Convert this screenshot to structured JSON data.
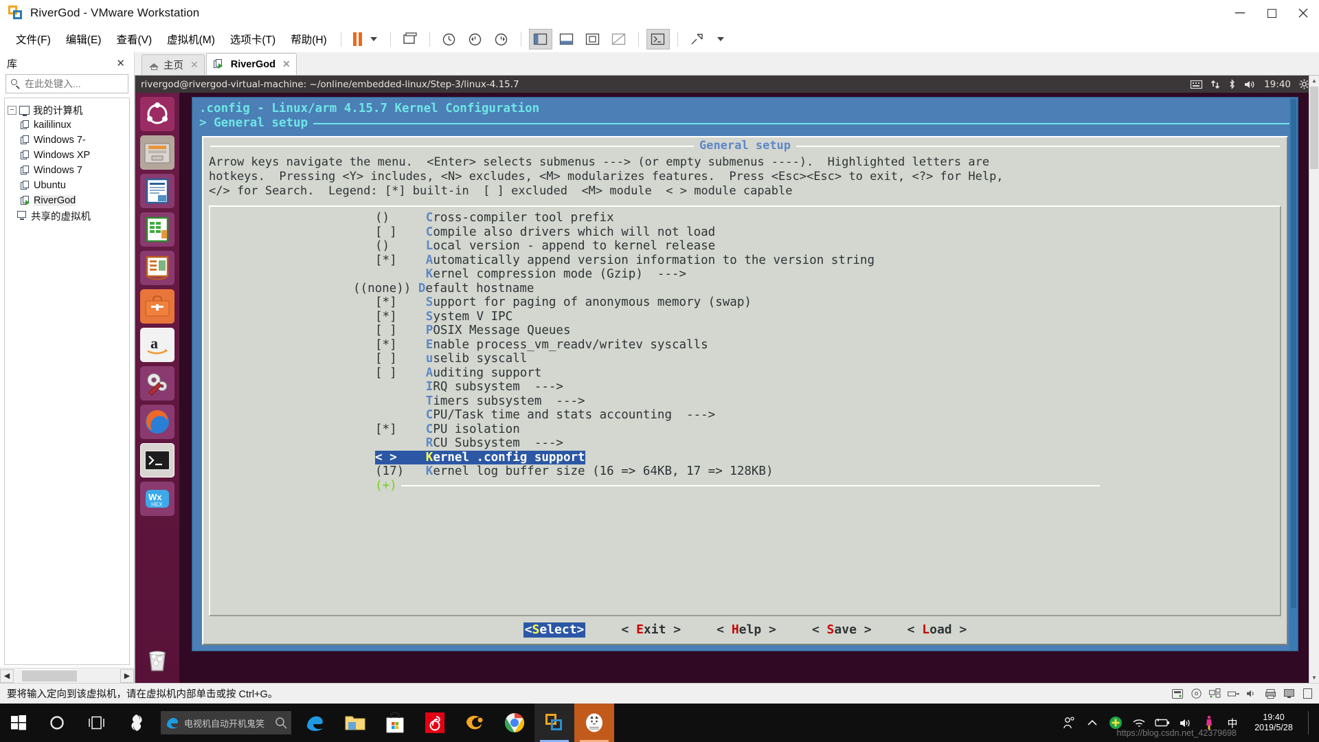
{
  "window": {
    "title": "RiverGod - VMware Workstation",
    "minimize": "–",
    "maximize": "❐",
    "close": "✕"
  },
  "menubar": {
    "items": [
      {
        "label": "文件(F)",
        "name": "menu-file"
      },
      {
        "label": "编辑(E)",
        "name": "menu-edit"
      },
      {
        "label": "查看(V)",
        "name": "menu-view"
      },
      {
        "label": "虚拟机(M)",
        "name": "menu-vm"
      },
      {
        "label": "选项卡(T)",
        "name": "menu-tabs"
      },
      {
        "label": "帮助(H)",
        "name": "menu-help"
      }
    ]
  },
  "library": {
    "title": "库",
    "close": "✕",
    "search_placeholder": "在此处键入...",
    "search_value": "",
    "tree": [
      {
        "label": "我的计算机",
        "type": "root",
        "indent": 0,
        "expander": "−"
      },
      {
        "label": "kaililinux",
        "type": "vm",
        "indent": 1
      },
      {
        "label": "Windows 7-",
        "type": "vm",
        "indent": 1
      },
      {
        "label": "Windows XP",
        "type": "vm",
        "indent": 1
      },
      {
        "label": "Windows 7",
        "type": "vm",
        "indent": 1
      },
      {
        "label": "Ubuntu",
        "type": "vm",
        "indent": 1
      },
      {
        "label": "RiverGod",
        "type": "vm-running",
        "indent": 1,
        "selected": true
      },
      {
        "label": "共享的虚拟机",
        "type": "shared",
        "indent": 0
      }
    ]
  },
  "tabs": [
    {
      "label": "主页",
      "icon": "home-icon",
      "active": false,
      "close": "✕"
    },
    {
      "label": "RiverGod",
      "icon": "vm-running-icon",
      "active": true,
      "close": "✕"
    }
  ],
  "vm": {
    "panel_title": "rivergod@rivergod-virtual-machine: ~/online/embedded-linux/Step-3/linux-4.15.7",
    "clock": "19:40",
    "tray_icons": [
      "keyboard-icon",
      "network-icon",
      "bluetooth-icon",
      "volume-icon",
      "system-gear-icon"
    ],
    "launcher": [
      {
        "name": "ubuntu-dash-icon",
        "label": "Dash"
      },
      {
        "name": "files-icon",
        "label": "Files",
        "running": true
      },
      {
        "name": "libreoffice-writer-icon",
        "label": "LibreOffice Writer"
      },
      {
        "name": "libreoffice-calc-icon",
        "label": "LibreOffice Calc"
      },
      {
        "name": "libreoffice-impress-icon",
        "label": "LibreOffice Impress"
      },
      {
        "name": "ubuntu-software-icon",
        "label": "Ubuntu Software"
      },
      {
        "name": "amazon-icon",
        "label": "Amazon"
      },
      {
        "name": "system-settings-icon",
        "label": "System Settings"
      },
      {
        "name": "firefox-icon",
        "label": "Firefox"
      },
      {
        "name": "terminal-icon",
        "label": "Terminal",
        "running": true,
        "current": true
      },
      {
        "name": "wxhexeditor-icon",
        "label": "wxHexEditor"
      },
      {
        "name": "trash-icon",
        "label": "Trash"
      }
    ]
  },
  "menuconfig": {
    "header_line1": ".config - Linux/arm 4.15.7 Kernel Configuration",
    "header_line2": "> General setup",
    "dialog_title": "General setup",
    "help_text": "Arrow keys navigate the menu.  <Enter> selects submenus ---> (or empty submenus ----).  Highlighted letters are\nhotkeys.  Pressing <Y> includes, <N> excludes, <M> modularizes features.  Press <Esc><Esc> to exit, <?> for Help,\n</> for Search.  Legend: [*] built-in  [ ] excluded  <M> module  < > module capable",
    "items": [
      {
        "prefix": "()     ",
        "hotkey": "C",
        "text": "ross-compiler tool prefix",
        "selected": false
      },
      {
        "prefix": "[ ]    ",
        "hotkey": "C",
        "text": "ompile also drivers which will not load",
        "selected": false
      },
      {
        "prefix": "()     ",
        "hotkey": "L",
        "text": "ocal version - append to kernel release",
        "selected": false
      },
      {
        "prefix": "[*]    ",
        "hotkey": "A",
        "text": "utomatically append version information to the version string",
        "selected": false
      },
      {
        "prefix": "       ",
        "hotkey": "K",
        "text": "ernel compression mode (Gzip)  --->",
        "selected": false
      },
      {
        "prefix": "((none)) ",
        "hotkey": "D",
        "text": "efault hostname",
        "selected": false
      },
      {
        "prefix": "[*]    ",
        "hotkey": "S",
        "text": "upport for paging of anonymous memory (swap)",
        "selected": false
      },
      {
        "prefix": "[*]    ",
        "hotkey": "S",
        "text": "ystem V IPC",
        "selected": false
      },
      {
        "prefix": "[ ]    ",
        "hotkey": "P",
        "text": "OSIX Message Queues",
        "selected": false
      },
      {
        "prefix": "[*]    ",
        "hotkey": "E",
        "text": "nable process_vm_readv/writev syscalls",
        "selected": false
      },
      {
        "prefix": "[ ]    ",
        "hotkey": "u",
        "text": "selib syscall",
        "selected": false
      },
      {
        "prefix": "[ ]    ",
        "hotkey": "A",
        "text": "uditing support",
        "selected": false
      },
      {
        "prefix": "       ",
        "hotkey": "I",
        "text": "RQ subsystem  --->",
        "selected": false
      },
      {
        "prefix": "       ",
        "hotkey": "T",
        "text": "imers subsystem  --->",
        "selected": false
      },
      {
        "prefix": "       ",
        "hotkey": "C",
        "text": "PU/Task time and stats accounting  --->",
        "selected": false
      },
      {
        "prefix": "[*]    ",
        "hotkey": "C",
        "text": "PU isolation",
        "selected": false
      },
      {
        "prefix": "       ",
        "hotkey": "R",
        "text": "CU Subsystem  --->",
        "selected": false
      },
      {
        "prefix": "< >    ",
        "hotkey": "K",
        "text": "ernel .config support",
        "selected": true
      },
      {
        "prefix": "(17)   ",
        "hotkey": "K",
        "text": "ernel log buffer size (16 => 64KB, 17 => 128KB)",
        "selected": false
      }
    ],
    "more_indicator": "(+)",
    "buttons": [
      {
        "left": "<",
        "before": "",
        "hotkey": "S",
        "after": "elect",
        "right": ">",
        "selected": true
      },
      {
        "left": "< ",
        "before": "",
        "hotkey": "E",
        "after": "xit ",
        "right": ">",
        "selected": false
      },
      {
        "left": "< ",
        "before": "",
        "hotkey": "H",
        "after": "elp ",
        "right": ">",
        "selected": false
      },
      {
        "left": "< ",
        "before": "",
        "hotkey": "S",
        "after": "ave ",
        "right": ">",
        "selected": false
      },
      {
        "left": "< ",
        "before": "",
        "hotkey": "L",
        "after": "oad ",
        "right": ">",
        "selected": false
      }
    ]
  },
  "statusbar": {
    "message": "要将输入定向到该虚拟机，请在虚拟机内部单击或按 Ctrl+G。"
  },
  "taskbar": {
    "search_placeholder": "电视机自动开机鬼笑",
    "items": [
      {
        "name": "start-button",
        "icon": "windows-logo-icon"
      },
      {
        "name": "cortana-button",
        "icon": "cortana-circle-icon"
      },
      {
        "name": "task-view-button",
        "icon": "task-view-icon"
      },
      {
        "name": "taskbar-app-sogou",
        "icon": "sogou-icon"
      }
    ],
    "pinned": [
      {
        "name": "taskbar-edge",
        "icon": "edge-icon"
      },
      {
        "name": "taskbar-file-explorer",
        "icon": "folder-icon"
      },
      {
        "name": "taskbar-store",
        "icon": "microsoft-store-icon"
      },
      {
        "name": "taskbar-netease-music",
        "icon": "netease-music-icon"
      },
      {
        "name": "taskbar-tencent-video",
        "icon": "tencent-video-icon"
      },
      {
        "name": "taskbar-chrome",
        "icon": "chrome-icon"
      },
      {
        "name": "taskbar-vmware",
        "icon": "vmware-icon",
        "active": true
      },
      {
        "name": "taskbar-app-orange",
        "icon": "cat-avatar-icon",
        "active2": true
      }
    ],
    "tray": [
      "people-icon",
      "show-hidden-icon",
      "security-shield-icon",
      "wifi-icon",
      "battery-icon",
      "volume-icon",
      "sogou-ime-icon",
      "ime-chinese-icon"
    ],
    "clock_time": "19:40",
    "clock_date": "2019/5/28",
    "watermark": "https://blog.csdn.net_42379698"
  }
}
